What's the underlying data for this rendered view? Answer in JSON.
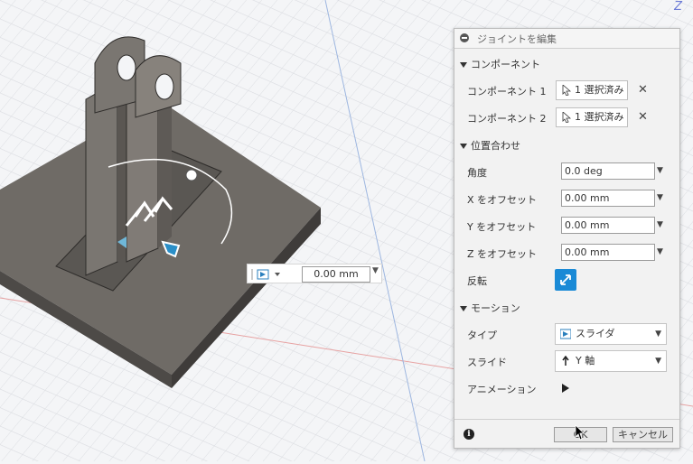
{
  "canvas": {
    "axis_label": "Z",
    "offset_value": "0.00 mm"
  },
  "dialog": {
    "title": "ジョイントを編集",
    "components_section": "コンポーネント",
    "component1_label": "コンポーネント 1",
    "component1_value": "1 選択済み",
    "component2_label": "コンポーネント 2",
    "component2_value": "1 選択済み",
    "alignment_section": "位置合わせ",
    "angle_label": "角度",
    "angle_value": "0.0 deg",
    "x_offset_label": "X をオフセット",
    "x_offset_value": "0.00 mm",
    "y_offset_label": "Y をオフセット",
    "y_offset_value": "0.00 mm",
    "z_offset_label": "Z をオフセット",
    "z_offset_value": "0.00 mm",
    "flip_label": "反転",
    "motion_section": "モーション",
    "type_label": "タイプ",
    "type_value": "スライダ",
    "slide_label": "スライド",
    "slide_value": "Y 軸",
    "animation_label": "アニメーション",
    "ok_label": "OK",
    "cancel_label": "キャンセル"
  },
  "colors": {
    "accent": "#1a8ad6",
    "part": "#6b6864"
  }
}
